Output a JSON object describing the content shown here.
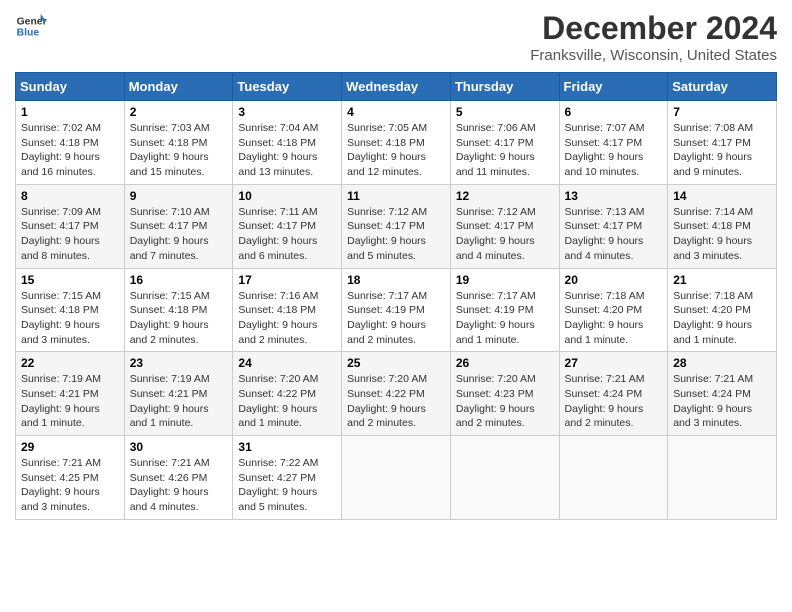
{
  "header": {
    "title": "December 2024",
    "location": "Franksville, Wisconsin, United States",
    "logo_general": "General",
    "logo_blue": "Blue"
  },
  "columns": [
    "Sunday",
    "Monday",
    "Tuesday",
    "Wednesday",
    "Thursday",
    "Friday",
    "Saturday"
  ],
  "weeks": [
    [
      {
        "day": "1",
        "sunrise": "7:02 AM",
        "sunset": "4:18 PM",
        "daylight": "9 hours and 16 minutes."
      },
      {
        "day": "2",
        "sunrise": "7:03 AM",
        "sunset": "4:18 PM",
        "daylight": "9 hours and 15 minutes."
      },
      {
        "day": "3",
        "sunrise": "7:04 AM",
        "sunset": "4:18 PM",
        "daylight": "9 hours and 13 minutes."
      },
      {
        "day": "4",
        "sunrise": "7:05 AM",
        "sunset": "4:18 PM",
        "daylight": "9 hours and 12 minutes."
      },
      {
        "day": "5",
        "sunrise": "7:06 AM",
        "sunset": "4:17 PM",
        "daylight": "9 hours and 11 minutes."
      },
      {
        "day": "6",
        "sunrise": "7:07 AM",
        "sunset": "4:17 PM",
        "daylight": "9 hours and 10 minutes."
      },
      {
        "day": "7",
        "sunrise": "7:08 AM",
        "sunset": "4:17 PM",
        "daylight": "9 hours and 9 minutes."
      }
    ],
    [
      {
        "day": "8",
        "sunrise": "7:09 AM",
        "sunset": "4:17 PM",
        "daylight": "9 hours and 8 minutes."
      },
      {
        "day": "9",
        "sunrise": "7:10 AM",
        "sunset": "4:17 PM",
        "daylight": "9 hours and 7 minutes."
      },
      {
        "day": "10",
        "sunrise": "7:11 AM",
        "sunset": "4:17 PM",
        "daylight": "9 hours and 6 minutes."
      },
      {
        "day": "11",
        "sunrise": "7:12 AM",
        "sunset": "4:17 PM",
        "daylight": "9 hours and 5 minutes."
      },
      {
        "day": "12",
        "sunrise": "7:12 AM",
        "sunset": "4:17 PM",
        "daylight": "9 hours and 4 minutes."
      },
      {
        "day": "13",
        "sunrise": "7:13 AM",
        "sunset": "4:17 PM",
        "daylight": "9 hours and 4 minutes."
      },
      {
        "day": "14",
        "sunrise": "7:14 AM",
        "sunset": "4:18 PM",
        "daylight": "9 hours and 3 minutes."
      }
    ],
    [
      {
        "day": "15",
        "sunrise": "7:15 AM",
        "sunset": "4:18 PM",
        "daylight": "9 hours and 3 minutes."
      },
      {
        "day": "16",
        "sunrise": "7:15 AM",
        "sunset": "4:18 PM",
        "daylight": "9 hours and 2 minutes."
      },
      {
        "day": "17",
        "sunrise": "7:16 AM",
        "sunset": "4:18 PM",
        "daylight": "9 hours and 2 minutes."
      },
      {
        "day": "18",
        "sunrise": "7:17 AM",
        "sunset": "4:19 PM",
        "daylight": "9 hours and 2 minutes."
      },
      {
        "day": "19",
        "sunrise": "7:17 AM",
        "sunset": "4:19 PM",
        "daylight": "9 hours and 1 minute."
      },
      {
        "day": "20",
        "sunrise": "7:18 AM",
        "sunset": "4:20 PM",
        "daylight": "9 hours and 1 minute."
      },
      {
        "day": "21",
        "sunrise": "7:18 AM",
        "sunset": "4:20 PM",
        "daylight": "9 hours and 1 minute."
      }
    ],
    [
      {
        "day": "22",
        "sunrise": "7:19 AM",
        "sunset": "4:21 PM",
        "daylight": "9 hours and 1 minute."
      },
      {
        "day": "23",
        "sunrise": "7:19 AM",
        "sunset": "4:21 PM",
        "daylight": "9 hours and 1 minute."
      },
      {
        "day": "24",
        "sunrise": "7:20 AM",
        "sunset": "4:22 PM",
        "daylight": "9 hours and 1 minute."
      },
      {
        "day": "25",
        "sunrise": "7:20 AM",
        "sunset": "4:22 PM",
        "daylight": "9 hours and 2 minutes."
      },
      {
        "day": "26",
        "sunrise": "7:20 AM",
        "sunset": "4:23 PM",
        "daylight": "9 hours and 2 minutes."
      },
      {
        "day": "27",
        "sunrise": "7:21 AM",
        "sunset": "4:24 PM",
        "daylight": "9 hours and 2 minutes."
      },
      {
        "day": "28",
        "sunrise": "7:21 AM",
        "sunset": "4:24 PM",
        "daylight": "9 hours and 3 minutes."
      }
    ],
    [
      {
        "day": "29",
        "sunrise": "7:21 AM",
        "sunset": "4:25 PM",
        "daylight": "9 hours and 3 minutes."
      },
      {
        "day": "30",
        "sunrise": "7:21 AM",
        "sunset": "4:26 PM",
        "daylight": "9 hours and 4 minutes."
      },
      {
        "day": "31",
        "sunrise": "7:22 AM",
        "sunset": "4:27 PM",
        "daylight": "9 hours and 5 minutes."
      },
      null,
      null,
      null,
      null
    ]
  ],
  "labels": {
    "sunrise": "Sunrise:",
    "sunset": "Sunset:",
    "daylight": "Daylight:"
  }
}
